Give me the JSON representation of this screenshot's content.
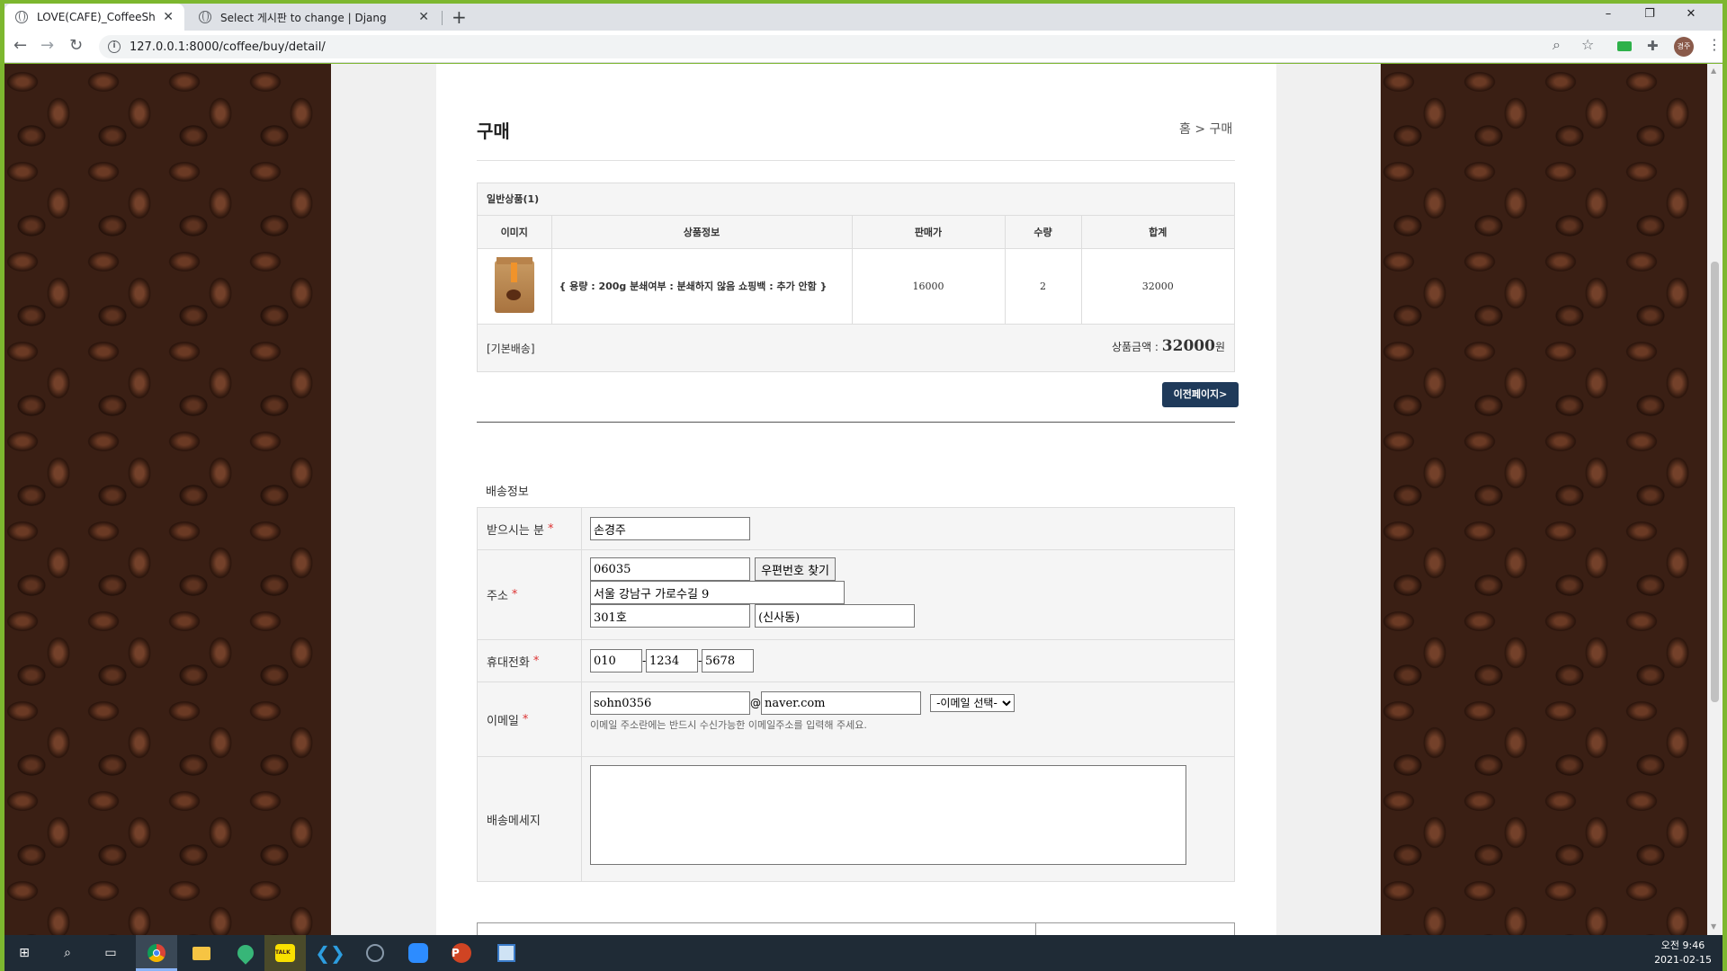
{
  "browser": {
    "tabs": [
      {
        "title": "LOVE(CAFE)_CoffeeShop",
        "active": true
      },
      {
        "title": "Select 게시판 to change | Djang",
        "active": false
      }
    ],
    "new_tab": "+",
    "url": "127.0.0.1:8000/coffee/buy/detail/",
    "profile_initials": "경주",
    "window_controls": {
      "minimize": "–",
      "restore": "❐",
      "close": "✕"
    }
  },
  "page": {
    "title": "구매",
    "breadcrumb": "홈 > 구매"
  },
  "cart": {
    "group_label": "일반상품(1)",
    "columns": [
      "이미지",
      "상품정보",
      "판매가",
      "수량",
      "합계"
    ],
    "items": [
      {
        "image": "coffee-bag",
        "info": "{ 용량 : 200g 분쇄여부 : 분쇄하지 않음 쇼핑백 : 추가 안함 }",
        "price": "16000",
        "qty": "2",
        "total": "32000"
      }
    ],
    "shipping_type": "[기본배송]",
    "subtotal_label": "상품금액 : ",
    "subtotal_amount": "32000",
    "subtotal_unit": "원",
    "prev_button": "이전페이지>"
  },
  "shipping": {
    "section_title": "배송정보",
    "recipient_label": "받으시는 분",
    "recipient_value": "손경주",
    "address_label": "주소",
    "zipcode": "06035",
    "zip_button": "우편번호 찾기",
    "address1": "서울 강남구 가로수길 9",
    "address2": "301호",
    "address3": "(신사동)",
    "phone_label": "휴대전화",
    "phone1": "010",
    "phone2": "1234",
    "phone3": "5678",
    "email_label": "이메일",
    "email_id": "sohn0356",
    "email_at": "@",
    "email_domain": "naver.com",
    "email_select": "-이메일 선택-",
    "email_hint": "이메일 주소란에는 반드시 수신가능한 이메일주소를 입력해 주세요.",
    "message_label": "배송메세지",
    "message_value": "",
    "required_mark": "*"
  },
  "taskbar": {
    "time": "오전 9:46",
    "date": "2021-02-15"
  },
  "colors": {
    "accent_button": "#1f3a5a",
    "required": "#dd3333",
    "window_border": "#7db72f"
  }
}
